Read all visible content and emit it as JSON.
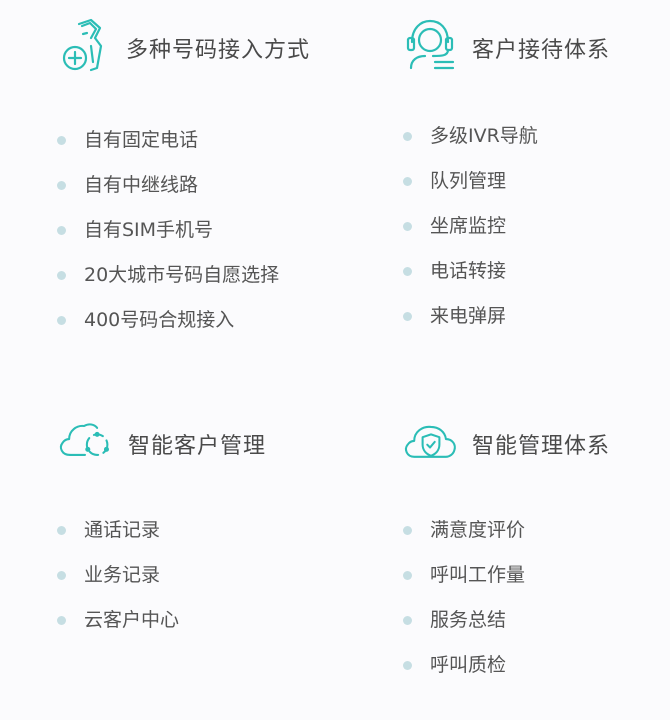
{
  "colors": {
    "accent": "#2bbdb6",
    "bullet": "#c6dee3",
    "title_text": "#4a4a4a",
    "item_text": "#555555",
    "background": "#fbfbfd"
  },
  "sections": {
    "number_access": {
      "icon": "phone-plus-icon",
      "title": "多种号码接入方式",
      "items": [
        "自有固定电话",
        "自有中继线路",
        "自有SIM手机号",
        "20大城市号码自愿选择",
        "400号码合规接入"
      ]
    },
    "customer_reception": {
      "icon": "headset-agent-icon",
      "title": "客户接待体系",
      "items": [
        "多级IVR导航",
        "队列管理",
        "坐席监控",
        "电话转接",
        "来电弹屏"
      ]
    },
    "customer_management": {
      "icon": "cloud-sync-icon",
      "title": "智能客户管理",
      "items": [
        "通话记录",
        "业务记录",
        "云客户中心"
      ]
    },
    "smart_management": {
      "icon": "cloud-shield-icon",
      "title": "智能管理体系",
      "items": [
        "满意度评价",
        "呼叫工作量",
        "服务总结",
        "呼叫质检"
      ]
    }
  }
}
